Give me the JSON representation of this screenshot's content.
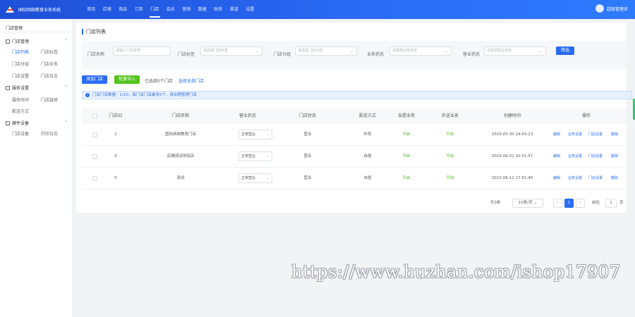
{
  "app": {
    "title": "国际网络教育业务系统"
  },
  "topnav": [
    {
      "label": "首页"
    },
    {
      "label": "店铺"
    },
    {
      "label": "商品"
    },
    {
      "label": "订单"
    },
    {
      "label": "门店"
    },
    {
      "label": "会员"
    },
    {
      "label": "营销"
    },
    {
      "label": "数据"
    },
    {
      "label": "财务"
    },
    {
      "label": "渠道"
    },
    {
      "label": "设置"
    }
  ],
  "user": {
    "name": "超级管理员"
  },
  "sidebar": {
    "title": "门店管理",
    "groups": [
      {
        "label": "门店管理",
        "links": [
          {
            "label": "门店列表"
          },
          {
            "label": "门店标签"
          },
          {
            "label": "门店分组"
          },
          {
            "label": "门店业务"
          },
          {
            "label": "门店设置"
          },
          {
            "label": "门店日志"
          }
        ]
      },
      {
        "label": "服务设置",
        "links": [
          {
            "label": "服务时间"
          },
          {
            "label": "门店装修"
          },
          {
            "label": "配送方式"
          }
        ]
      },
      {
        "label": "硬件设备",
        "links": [
          {
            "label": "门店设备"
          },
          {
            "label": "打印日志"
          }
        ]
      }
    ]
  },
  "page": {
    "title": "门店列表"
  },
  "filters": {
    "name_label": "门店名称",
    "name_placeholder": "请输入门店名称",
    "tag_label": "门店标签",
    "tag_placeholder": "请选择门店标签",
    "group_label": "门店分组",
    "group_placeholder": "请选择门店分组",
    "biz_label": "业务状态",
    "biz_placeholder": "请选择业务状态",
    "status_label": "营业状态",
    "status_placeholder": "请选择营业状态",
    "search_button": "筛选"
  },
  "actions": {
    "add_button": "添加门店",
    "import_button": "批量导入",
    "selected_text": "已选择0个门店",
    "select_all_link": "选择全部门店"
  },
  "alert": {
    "text": "门店门店数量：1/10，每门店门店最多5个，请合理管理门店"
  },
  "table": {
    "headers": [
      "门店ID",
      "门店名称",
      "营业状态",
      "门店状态",
      "配送方式",
      "自提业务",
      "外送业务",
      "创建时间",
      "操作"
    ],
    "rows": [
      {
        "id": "1",
        "name": "国际网络教育门店",
        "open_status": "正常营业",
        "store_status": "营业",
        "delivery": "外卖",
        "pickup": "开启",
        "takeout": "开启",
        "created": "2023-05-30 14:43:23",
        "ops": [
          "编辑",
          "业务设置",
          "门店设置",
          "删除"
        ]
      },
      {
        "id": "2",
        "name": "店铺测试体验店",
        "open_status": "正常营业",
        "store_status": "营业",
        "delivery": "自提",
        "pickup": "开启",
        "takeout": "开启",
        "created": "2023-06-01 10:51:57",
        "ops": [
          "编辑",
          "业务设置",
          "门店设置",
          "删除"
        ]
      },
      {
        "id": "5",
        "name": "测试",
        "open_status": "正常营业",
        "store_status": "营业",
        "delivery": "自提",
        "pickup": "开启",
        "takeout": "开启",
        "created": "2023-06-12 17:51:40",
        "ops": [
          "编辑",
          "业务设置",
          "门店设置",
          "删除"
        ]
      }
    ]
  },
  "pagination": {
    "total_text": "共3条",
    "page_size": "10条/页",
    "prev": "<",
    "current": "1",
    "next": ">",
    "goto_label": "前往",
    "goto_value": "1",
    "page_suffix": "页"
  },
  "watermark": "https://www.huzhan.com/ishop17907",
  "colors": {
    "primary": "#2a6cf6",
    "success": "#52c41a",
    "nav_bg": "#1e4fd8"
  }
}
